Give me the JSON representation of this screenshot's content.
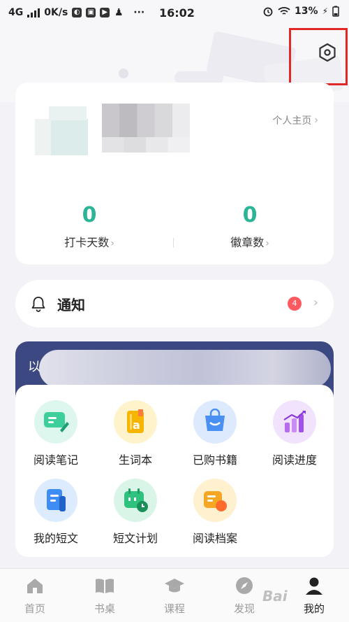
{
  "status_bar": {
    "network": "4G",
    "speed": "0K/s",
    "time": "16:02",
    "dots": "···",
    "battery": "13%"
  },
  "profile": {
    "profile_link": "个人主页",
    "stats": [
      {
        "value": "0",
        "label": "打卡天数"
      },
      {
        "value": "0",
        "label": "徽章数"
      }
    ]
  },
  "notification": {
    "label": "通知",
    "badge": "4"
  },
  "banner": {
    "leading_char": "以"
  },
  "tools": [
    {
      "label": "阅读笔记",
      "icon": "reading-notes-icon",
      "color": "#3ccf9a"
    },
    {
      "label": "生词本",
      "icon": "vocabulary-book-icon",
      "color": "#f7b500"
    },
    {
      "label": "已购书籍",
      "icon": "purchased-books-icon",
      "color": "#4a90f2"
    },
    {
      "label": "阅读进度",
      "icon": "reading-progress-icon",
      "color": "#b56cf0"
    },
    {
      "label": "我的短文",
      "icon": "my-essays-icon",
      "color": "#3d8df5"
    },
    {
      "label": "短文计划",
      "icon": "essay-plan-icon",
      "color": "#2ec27e"
    },
    {
      "label": "阅读档案",
      "icon": "reading-archive-icon",
      "color": "#f5a623"
    }
  ],
  "bottom_nav": [
    {
      "label": "首页",
      "icon": "home-icon"
    },
    {
      "label": "书桌",
      "icon": "book-icon"
    },
    {
      "label": "课程",
      "icon": "graduation-cap-icon"
    },
    {
      "label": "发现",
      "icon": "compass-icon"
    },
    {
      "label": "我的",
      "icon": "user-icon",
      "active": true
    }
  ],
  "watermark": "Bai"
}
